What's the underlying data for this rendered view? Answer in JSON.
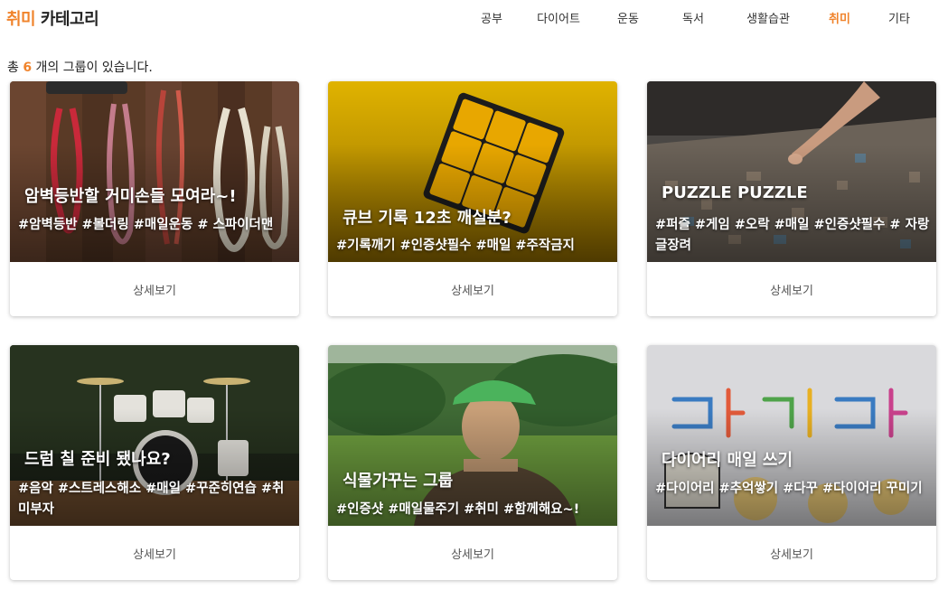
{
  "header": {
    "title_accent": "취미",
    "title_rest": " 카테고리",
    "nav": [
      {
        "label": "공부",
        "active": false
      },
      {
        "label": "다이어트",
        "active": false
      },
      {
        "label": "운동",
        "active": false
      },
      {
        "label": "독서",
        "active": false
      },
      {
        "label": "생활습관",
        "active": false
      },
      {
        "label": "취미",
        "active": true
      },
      {
        "label": "기타",
        "active": false
      }
    ]
  },
  "summary": {
    "prefix": "총 ",
    "count": "6",
    "suffix": " 개의 그룹이 있습니다."
  },
  "accent_color": "#f0832b",
  "groups": [
    {
      "title": "암벽등반할 거미손들 모여라~!",
      "tags": "#암벽등반 #볼더링 #매일운동 # 스파이더맨",
      "button": "상세보기",
      "image": "climbing-ropes-image"
    },
    {
      "title": "큐브 기록 12초 깨실분?",
      "tags": "#기록깨기 #인증샷필수 #매일 #주작금지",
      "button": "상세보기",
      "image": "rubiks-cube-image"
    },
    {
      "title": "PUZZLE PUZZLE",
      "tags": "#퍼즐 #게임 #오락 #매일 #인증샷필수 # 자랑글장려",
      "button": "상세보기",
      "image": "jigsaw-puzzle-image"
    },
    {
      "title": "드럼 칠 준비 됐나요?",
      "tags": "#음악 #스트레스해소 #매일 #꾸준히연습 #취미부자",
      "button": "상세보기",
      "image": "drum-kit-image"
    },
    {
      "title": "식물가꾸는 그룹",
      "tags": "#인증샷 #매일물주기 #취미 #함께해요~!",
      "button": "상세보기",
      "image": "farmer-portrait-image"
    },
    {
      "title": "다이어리 매일 쓰기",
      "tags": "#다이어리 #추억쌓기 #다꾸 #다이어리 꾸미기",
      "button": "상세보기",
      "image": "diary-drawing-image"
    }
  ]
}
